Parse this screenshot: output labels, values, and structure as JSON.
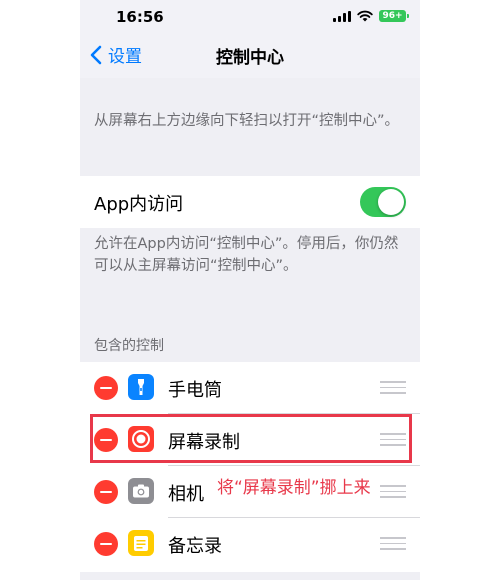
{
  "status_bar": {
    "time": "16:56",
    "battery": "96+"
  },
  "nav": {
    "back_label": "设置",
    "title": "控制中心"
  },
  "description_top": "从屏幕右上方边缘向下轻扫以打开“控制中心”。",
  "app_access": {
    "label": "App内访问",
    "enabled": true
  },
  "description_access": "允许在App内访问“控制中心”。停用后，你仍然可以从主屏幕访问“控制中心”。",
  "section_header": "包含的控制",
  "controls": [
    {
      "label": "手电筒",
      "icon": "flashlight-icon",
      "color": "#0a84ff"
    },
    {
      "label": "屏幕录制",
      "icon": "screen-record-icon",
      "color": "#ff3b30"
    },
    {
      "label": "相机",
      "icon": "camera-icon",
      "color": "#8e8e93"
    },
    {
      "label": "备忘录",
      "icon": "notes-icon",
      "color": "#ffcc00"
    }
  ],
  "annotation": "将“屏幕录制”挪上来",
  "colors": {
    "accent": "#007aff",
    "toggle_on": "#34c759",
    "delete": "#ff3b30",
    "highlight": "#e8384a"
  }
}
